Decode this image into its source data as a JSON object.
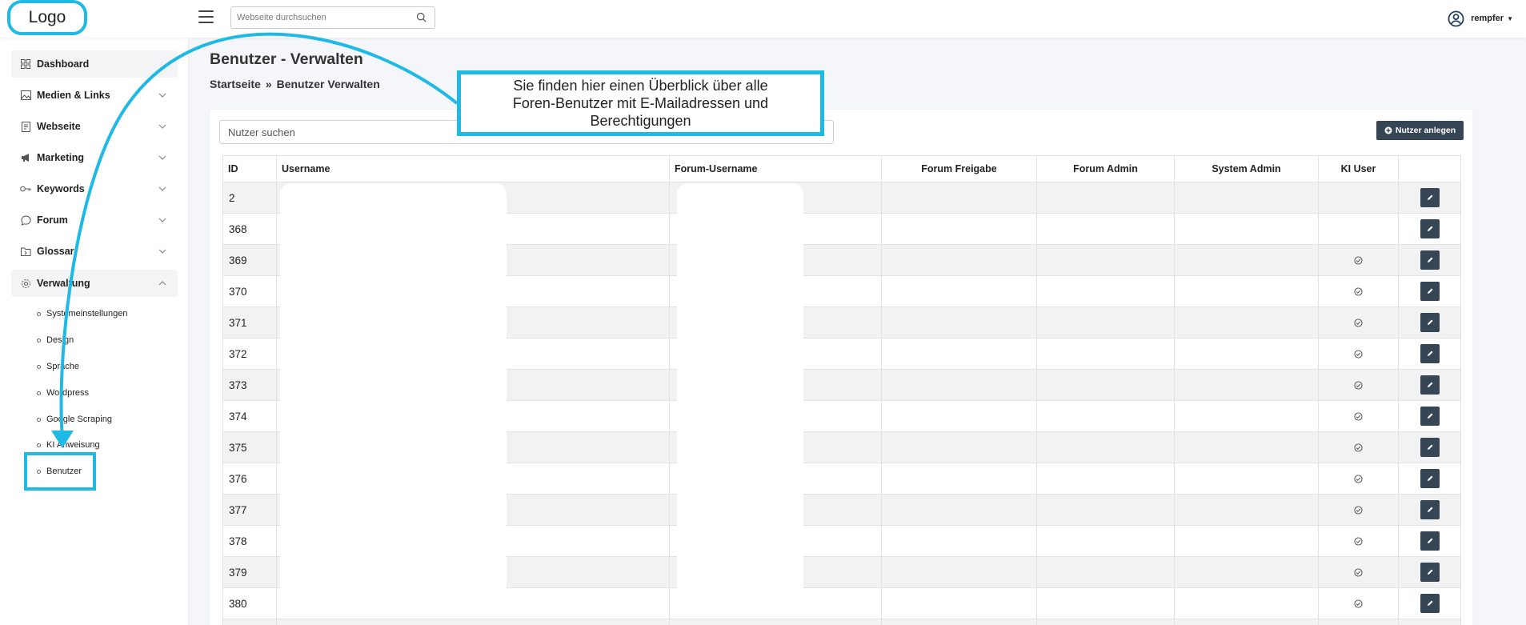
{
  "header": {
    "logo_text": "Logo",
    "search_placeholder": "Webseite durchsuchen",
    "username": "rempfer"
  },
  "sidebar": {
    "items": [
      {
        "label": "Dashboard",
        "icon": "grid-icon"
      },
      {
        "label": "Medien & Links",
        "icon": "image-icon"
      },
      {
        "label": "Webseite",
        "icon": "document-icon"
      },
      {
        "label": "Marketing",
        "icon": "megaphone-icon"
      },
      {
        "label": "Keywords",
        "icon": "key-icon"
      },
      {
        "label": "Forum",
        "icon": "chat-icon"
      },
      {
        "label": "Glossar",
        "icon": "folder-icon"
      },
      {
        "label": "Verwaltung",
        "icon": "gear-icon"
      }
    ],
    "subitems": [
      {
        "label": "Systemeinstellungen"
      },
      {
        "label": "Design"
      },
      {
        "label": "Sprache"
      },
      {
        "label": "Wordpress"
      },
      {
        "label": "Google Scraping"
      },
      {
        "label": "KI Anweisung"
      },
      {
        "label": "Benutzer"
      }
    ]
  },
  "main": {
    "title": "Benutzer - Verwalten",
    "breadcrumb": {
      "home": "Startseite",
      "separator": "»",
      "current": "Benutzer Verwalten"
    },
    "user_search_placeholder": "Nutzer suchen",
    "add_button_label": "Nutzer anlegen"
  },
  "table": {
    "columns": [
      "ID",
      "Username",
      "Forum-Username",
      "Forum Freigabe",
      "Forum Admin",
      "System Admin",
      "KI User",
      ""
    ],
    "rows": [
      {
        "id": "2",
        "ki_user": false
      },
      {
        "id": "368",
        "ki_user": false
      },
      {
        "id": "369",
        "ki_user": true
      },
      {
        "id": "370",
        "ki_user": true
      },
      {
        "id": "371",
        "ki_user": true
      },
      {
        "id": "372",
        "ki_user": true
      },
      {
        "id": "373",
        "ki_user": true
      },
      {
        "id": "374",
        "ki_user": true
      },
      {
        "id": "375",
        "ki_user": true
      },
      {
        "id": "376",
        "ki_user": true
      },
      {
        "id": "377",
        "ki_user": true
      },
      {
        "id": "378",
        "ki_user": true
      },
      {
        "id": "379",
        "ki_user": true
      },
      {
        "id": "380",
        "ki_user": true
      },
      {
        "id": "",
        "ki_user": false
      }
    ]
  },
  "annotation": {
    "callout_text": "Sie finden hier einen Überblick über alle Foren-Benutzer mit E-Mailadressen und Berechtigungen"
  },
  "colors": {
    "accent": "#1fb9e6",
    "button_dark": "#364655"
  }
}
